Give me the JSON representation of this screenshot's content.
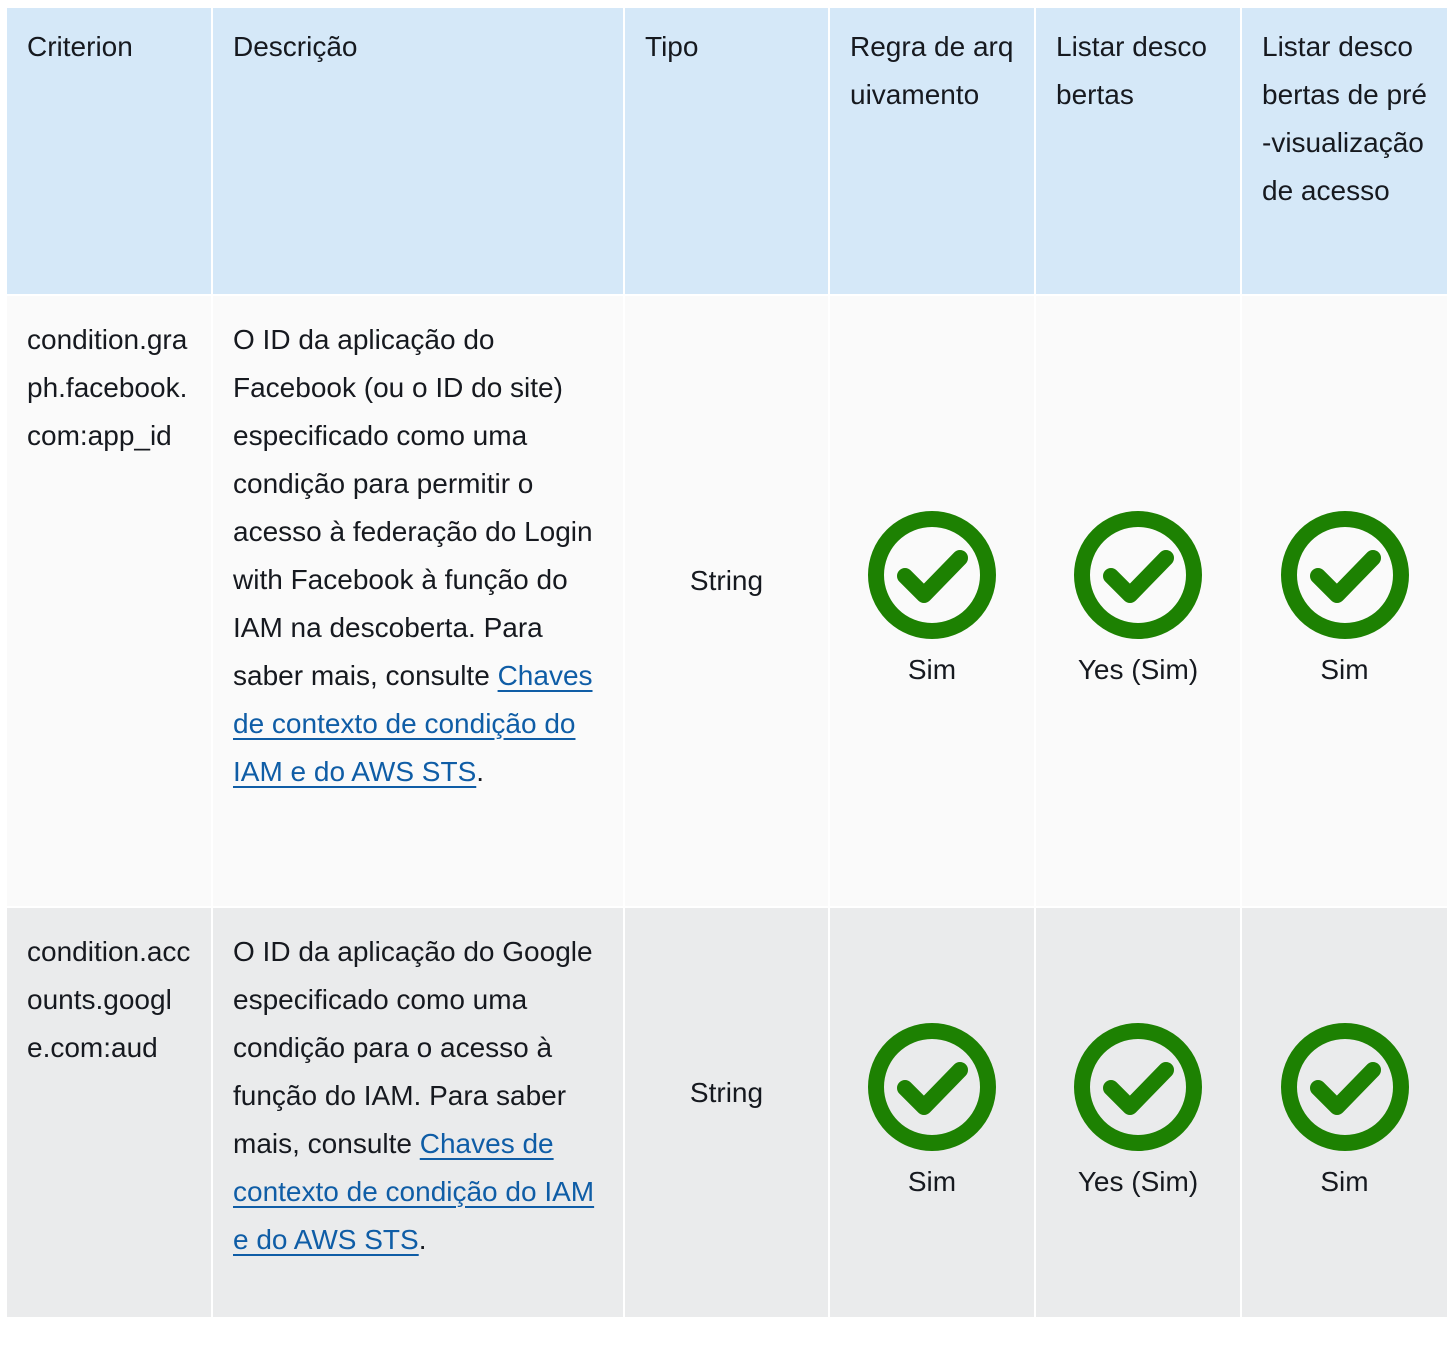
{
  "colors": {
    "header_bg": "#d5e8f8",
    "row_odd_bg": "#fafafa",
    "row_even_bg": "#eaebec",
    "link": "#0f5da6",
    "check_green": "#1d8102"
  },
  "table": {
    "headers": [
      "Criterion",
      "Descrição",
      "Tipo",
      "Regra de arquivamento",
      "Listar descobertas",
      "Listar descobertas de pré-visualização de acesso"
    ],
    "rows": [
      {
        "criterion": "condition.graph.facebook.com:app_id",
        "description_text": "O ID da aplicação do Facebook (ou o ID do site) especificado como uma condição para permitir o acesso à federação do Login with Facebook à função do IAM na descoberta. Para saber mais, consulte ",
        "description_link": "Chaves de contexto de condição do IAM e do AWS STS",
        "description_end": ".",
        "type": "String",
        "archive_rule": {
          "icon": "check-circle-icon",
          "label": "Sim"
        },
        "list_findings": {
          "icon": "check-circle-icon",
          "label": "Yes (Sim)"
        },
        "list_access_preview_findings": {
          "icon": "check-circle-icon",
          "label": "Sim"
        }
      },
      {
        "criterion": "condition.accounts.google.com:aud",
        "description_text": "O ID da aplicação do Google especificado como uma condição para o acesso à função do IAM. Para saber mais, consulte ",
        "description_link": "Chaves de contexto de condição do IAM e do AWS STS",
        "description_end": ".",
        "type": "String",
        "archive_rule": {
          "icon": "check-circle-icon",
          "label": "Sim"
        },
        "list_findings": {
          "icon": "check-circle-icon",
          "label": "Yes (Sim)"
        },
        "list_access_preview_findings": {
          "icon": "check-circle-icon",
          "label": "Sim"
        }
      }
    ]
  }
}
